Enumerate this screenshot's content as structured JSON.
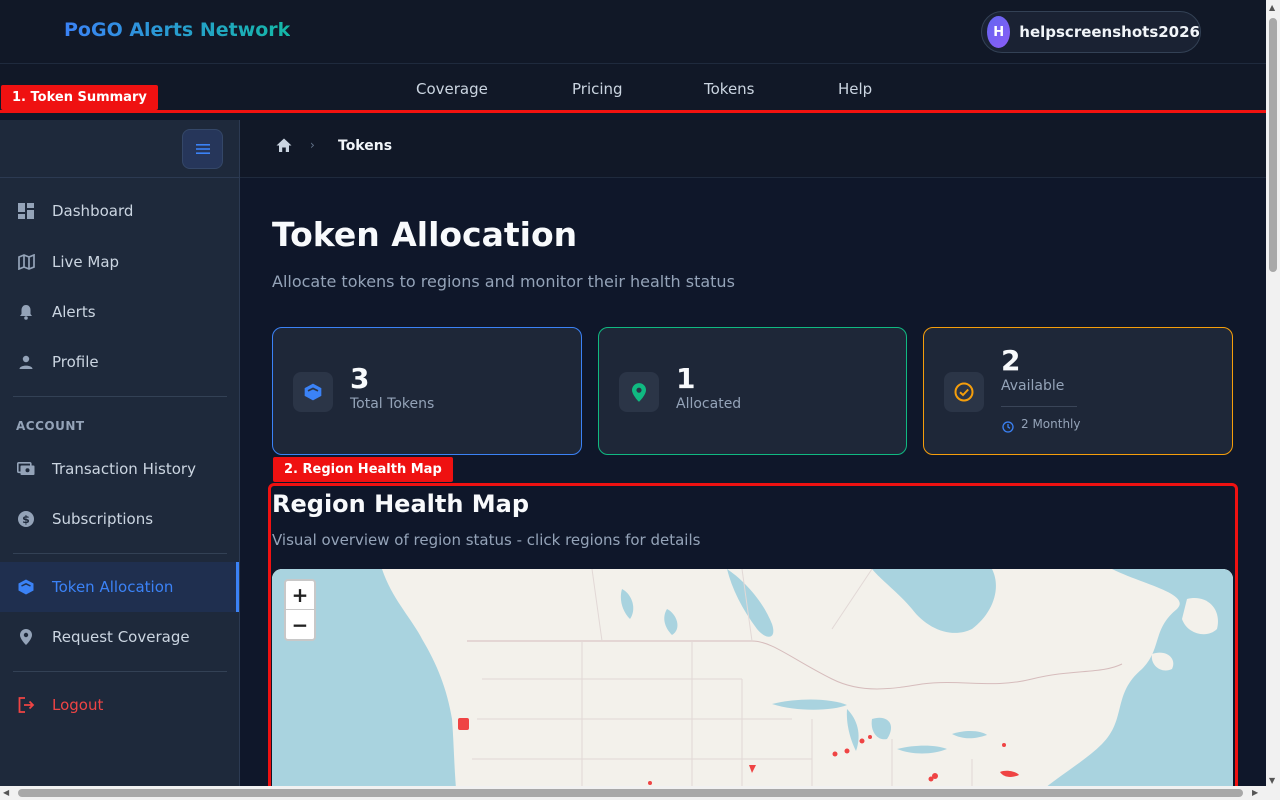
{
  "header": {
    "brand": "PoGO Alerts Network",
    "user_initial": "H",
    "username": "helpscreenshots2026"
  },
  "nav": [
    "Coverage",
    "Pricing",
    "Tokens",
    "Help"
  ],
  "annotations": {
    "tag1": "1. Token Summary",
    "tag2": "2. Region Health Map"
  },
  "sidebar": {
    "items": [
      {
        "label": "Dashboard",
        "icon": "dashboard-icon"
      },
      {
        "label": "Live Map",
        "icon": "map-icon"
      },
      {
        "label": "Alerts",
        "icon": "bell-icon"
      },
      {
        "label": "Profile",
        "icon": "user-icon"
      }
    ],
    "section_label": "ACCOUNT",
    "account_items": [
      {
        "label": "Transaction History",
        "icon": "receipt-icon"
      },
      {
        "label": "Subscriptions",
        "icon": "dollar-icon"
      }
    ],
    "active_item": "Token Allocation",
    "request_item": "Request Coverage",
    "logout": "Logout"
  },
  "breadcrumb": {
    "current": "Tokens"
  },
  "page": {
    "title": "Token Allocation",
    "subtitle": "Allocate tokens to regions and monitor their health status"
  },
  "stats": {
    "total": {
      "value": "3",
      "label": "Total Tokens",
      "color": "#3b82f6"
    },
    "allocated": {
      "value": "1",
      "label": "Allocated",
      "color": "#10b981"
    },
    "available": {
      "value": "2",
      "label": "Available",
      "sub": "2 Monthly",
      "color": "#f59e0b"
    }
  },
  "map_section": {
    "title": "Region Health Map",
    "subtitle": "Visual overview of region status - click regions for details",
    "zoom_in": "+",
    "zoom_out": "−"
  }
}
